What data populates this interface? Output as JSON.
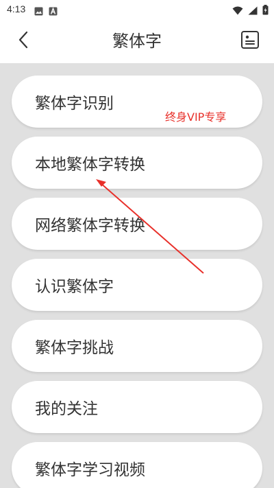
{
  "status_bar": {
    "time": "4:13",
    "left_icons": [
      "image-icon",
      "a-badge-icon"
    ],
    "right_icons": [
      "wifi-icon",
      "signal-icon",
      "battery-charging-icon"
    ]
  },
  "app_bar": {
    "title": "繁体字",
    "back_icon": "chevron-left-icon",
    "action_icon": "profile-card-icon"
  },
  "menu": {
    "items": [
      {
        "label": "繁体字识别"
      },
      {
        "label": "本地繁体字转换"
      },
      {
        "label": "网络繁体字转换"
      },
      {
        "label": "认识繁体字"
      },
      {
        "label": "繁体字挑战"
      },
      {
        "label": "我的关注"
      },
      {
        "label": "繁体字学习视频"
      }
    ],
    "vip_badge": "终身VIP专享"
  },
  "colors": {
    "background": "#e0e0e0",
    "card": "#ffffff",
    "text": "#333333",
    "vip": "#e8302a",
    "annotation": "#e8302a"
  }
}
